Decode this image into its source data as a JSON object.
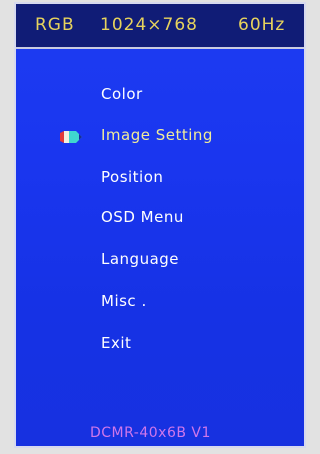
{
  "header": {
    "signal": "RGB",
    "resolution": "1024×768",
    "refresh_rate": "60Hz"
  },
  "menu": {
    "items": [
      {
        "label": "Color",
        "selected": false
      },
      {
        "label": "Image Setting",
        "selected": true
      },
      {
        "label": "Position",
        "selected": false
      },
      {
        "label": "OSD Menu",
        "selected": false
      },
      {
        "label": "Language",
        "selected": false
      },
      {
        "label": "Misc .",
        "selected": false
      },
      {
        "label": "Exit",
        "selected": false
      }
    ],
    "pointer_icon": "pencil-pointer-icon"
  },
  "footer": {
    "model": "DCMR-40x6B V1"
  },
  "colors": {
    "background": "#1a36ef",
    "header_bg": "#101c76",
    "header_text": "#e7d35d",
    "selected_text": "#f0ec9a",
    "footer_text": "#cf77ea"
  }
}
